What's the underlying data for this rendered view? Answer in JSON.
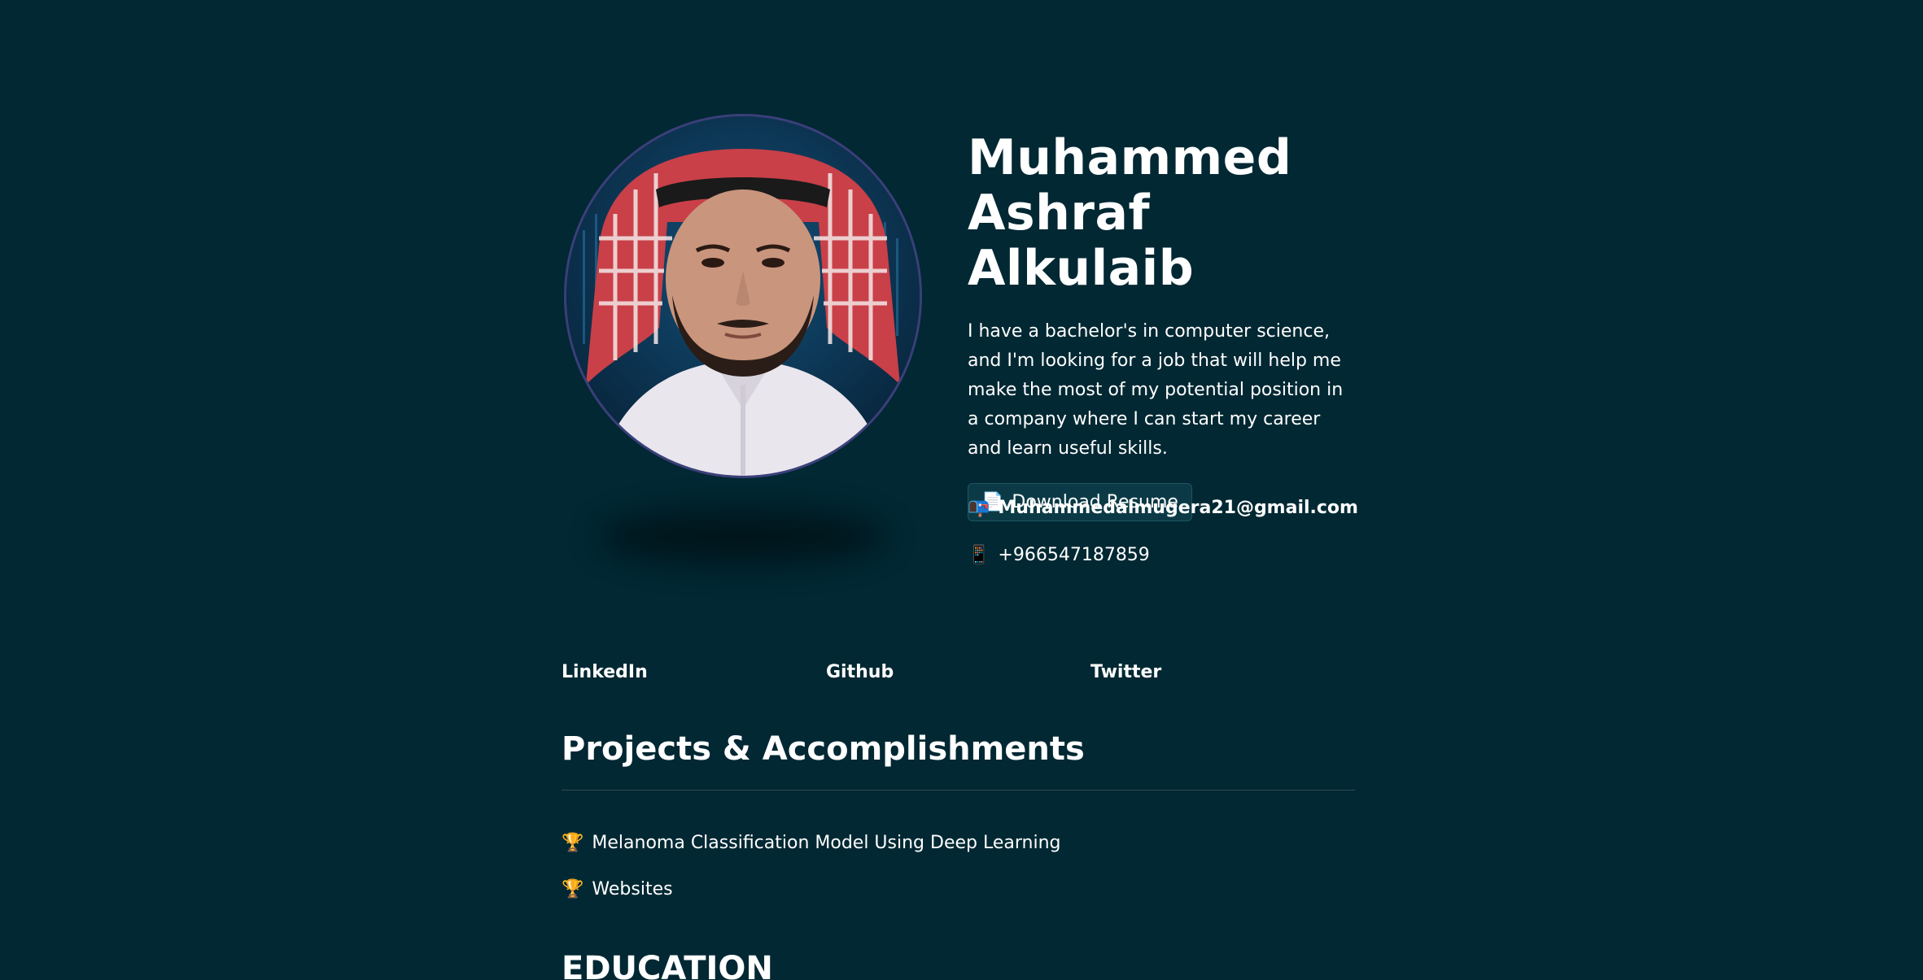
{
  "hero": {
    "name_line1": "Muhammed",
    "name_line2": "Ashraf Alkulaib",
    "bio": "I have a bachelor's in computer science, and I'm looking for a job that will help me make the most of my potential position in a company where I can start my career and learn useful skills.",
    "resume_button": {
      "icon": "📄",
      "label": "Download Resume"
    }
  },
  "contact": {
    "email_icon": "📭",
    "email": "Muhammedalmugera21@gmail.com",
    "phone_icon": "📱",
    "phone": "+966547187859"
  },
  "socials": [
    {
      "label": "LinkedIn"
    },
    {
      "label": "Github"
    },
    {
      "label": "Twitter"
    }
  ],
  "projects": {
    "title": "Projects & Accomplishments",
    "items": [
      {
        "icon": "🏆",
        "label": "Melanoma Classification Model Using Deep Learning"
      },
      {
        "icon": "🏆",
        "label": "Websites"
      }
    ]
  },
  "education": {
    "title": "EDUCATION"
  },
  "colors": {
    "background": "#012833",
    "text": "#ffffff",
    "avatar_border": "#3b3f7a",
    "button_bg": "#0b3a46"
  }
}
